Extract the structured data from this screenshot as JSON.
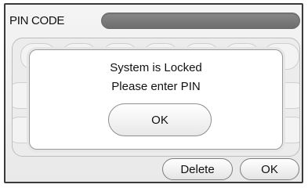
{
  "header": {
    "title": "PIN CODE"
  },
  "dialog": {
    "line1": "System is Locked",
    "line2": "Please enter PIN",
    "ok_label": "OK"
  },
  "actions": {
    "delete_label": "Delete",
    "ok_label": "OK"
  }
}
